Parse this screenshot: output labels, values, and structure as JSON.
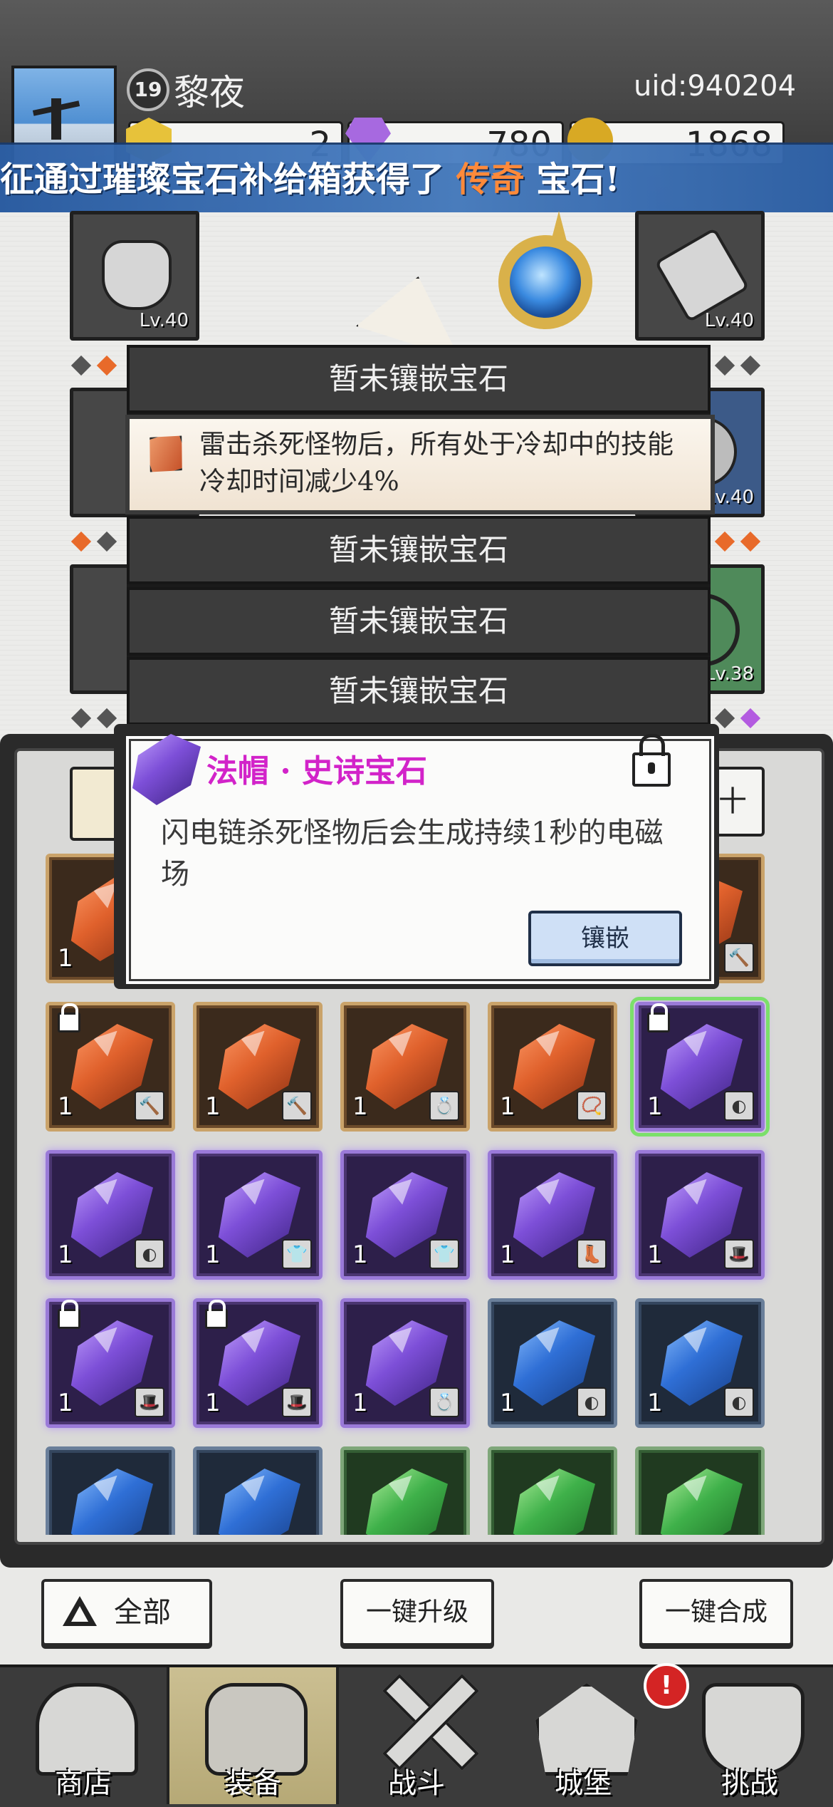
{
  "header": {
    "player_level": "19",
    "player_name": "黎夜",
    "uid": "uid:940204",
    "resources": [
      {
        "icon": "gold-gem-icon",
        "value": "2"
      },
      {
        "icon": "purple-diamond-icon",
        "value": "780"
      },
      {
        "icon": "gold-coin-icon",
        "value": "1868"
      }
    ]
  },
  "banner": {
    "prefix": "征通过璀璨宝石补给箱获得了 ",
    "highlight": "传奇",
    "suffix": " 宝石!",
    "highlight_color": "#ff8a3a"
  },
  "equipment": {
    "slots": [
      {
        "name": "hood",
        "level": "Lv.40"
      },
      {
        "name": "pants",
        "level": "Lv.40"
      },
      {
        "name": "ring",
        "level": "Lv.40"
      },
      {
        "name": "belt",
        "level": "Lv.38"
      }
    ]
  },
  "sockets": {
    "empty_label": "暂未镶嵌宝石",
    "filled_text": "雷击杀死怪物后，所有处于冷却中的技能冷却时间减少4%"
  },
  "popup": {
    "title": "法帽 · 史诗宝石",
    "title_color": "#d223c9",
    "description": "闪电链杀死怪物后会生成持续1秒的电磁场",
    "inlay_button": "镶嵌"
  },
  "bag": {
    "tab_right_label": "十",
    "gems": [
      {
        "rarity": "orange",
        "count": "1",
        "tag": "🔨",
        "locked": false
      },
      {
        "rarity": "orange",
        "count": "1",
        "tag": "",
        "locked": false
      },
      {
        "rarity": "orange",
        "count": "1",
        "tag": "",
        "locked": false
      },
      {
        "rarity": "orange",
        "count": "1",
        "tag": "",
        "locked": false
      },
      {
        "rarity": "orange",
        "count": "1",
        "tag": "🔨",
        "locked": false
      },
      {
        "rarity": "orange",
        "count": "1",
        "tag": "🔨",
        "locked": true
      },
      {
        "rarity": "orange",
        "count": "1",
        "tag": "🔨",
        "locked": false
      },
      {
        "rarity": "orange",
        "count": "1",
        "tag": "💍",
        "locked": false
      },
      {
        "rarity": "orange",
        "count": "1",
        "tag": "📿",
        "locked": false
      },
      {
        "rarity": "purple",
        "count": "1",
        "tag": "◐",
        "locked": true,
        "selected": true
      },
      {
        "rarity": "purple",
        "count": "1",
        "tag": "◐",
        "locked": false
      },
      {
        "rarity": "purple",
        "count": "1",
        "tag": "👕",
        "locked": false
      },
      {
        "rarity": "purple",
        "count": "1",
        "tag": "👕",
        "locked": false
      },
      {
        "rarity": "purple",
        "count": "1",
        "tag": "👢",
        "locked": false
      },
      {
        "rarity": "purple",
        "count": "1",
        "tag": "🎩",
        "locked": false
      },
      {
        "rarity": "purple",
        "count": "1",
        "tag": "🎩",
        "locked": true
      },
      {
        "rarity": "purple",
        "count": "1",
        "tag": "🎩",
        "locked": true
      },
      {
        "rarity": "purple",
        "count": "1",
        "tag": "💍",
        "locked": false
      },
      {
        "rarity": "blue",
        "count": "1",
        "tag": "◐",
        "locked": false
      },
      {
        "rarity": "blue",
        "count": "1",
        "tag": "◐",
        "locked": false
      },
      {
        "rarity": "blue",
        "count": "1",
        "tag": "",
        "locked": false
      },
      {
        "rarity": "blue",
        "count": "1",
        "tag": "",
        "locked": false
      },
      {
        "rarity": "green",
        "count": "1",
        "tag": "",
        "locked": false
      },
      {
        "rarity": "green",
        "count": "1",
        "tag": "",
        "locked": false
      },
      {
        "rarity": "green",
        "count": "1",
        "tag": "",
        "locked": false
      }
    ]
  },
  "actions": {
    "filter_all": "全部",
    "upgrade_all": "一键升级",
    "combine_all": "一键合成"
  },
  "nav": {
    "items": [
      {
        "label": "商店",
        "icon": "shop-icon"
      },
      {
        "label": "装备",
        "icon": "backpack-icon",
        "active": true
      },
      {
        "label": "战斗",
        "icon": "crossed-swords-icon"
      },
      {
        "label": "城堡",
        "icon": "castle-icon",
        "badge": "!"
      },
      {
        "label": "挑战",
        "icon": "shield-icon"
      }
    ]
  }
}
